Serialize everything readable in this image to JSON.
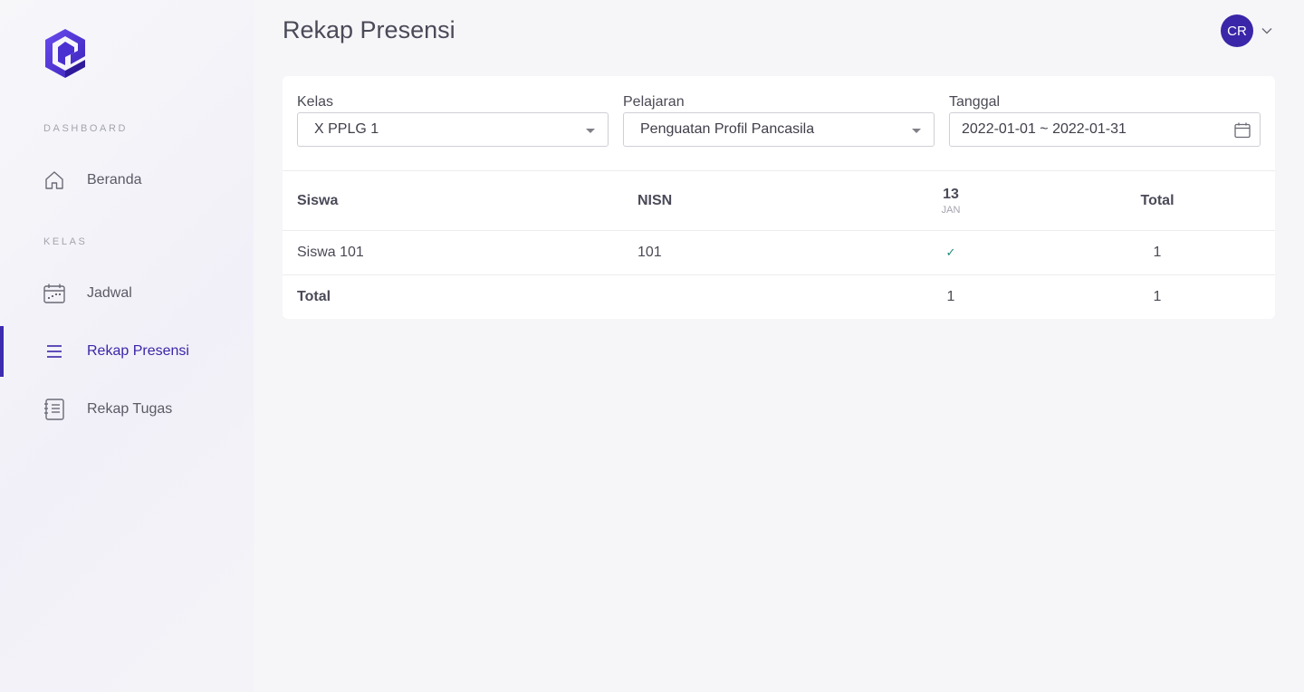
{
  "sidebar": {
    "sections": [
      {
        "label": "DASHBOARD"
      },
      {
        "label": "KELAS"
      }
    ],
    "items": [
      {
        "label": "Beranda",
        "icon": "home-icon"
      },
      {
        "label": "Jadwal",
        "icon": "calendar-icon"
      },
      {
        "label": "Rekap Presensi",
        "icon": "list-icon",
        "active": true
      },
      {
        "label": "Rekap Tugas",
        "icon": "notebook-icon"
      }
    ]
  },
  "header": {
    "title": "Rekap Presensi",
    "avatar_initials": "CR"
  },
  "filters": {
    "kelas": {
      "label": "Kelas",
      "value": "X PPLG 1"
    },
    "pelajaran": {
      "label": "Pelajaran",
      "value": "Penguatan Profil Pancasila"
    },
    "tanggal": {
      "label": "Tanggal",
      "value": "2022-01-01 ~ 2022-01-31"
    }
  },
  "table": {
    "headers": {
      "siswa": "Siswa",
      "nisn": "NISN",
      "date_day": "13",
      "date_month": "JAN",
      "total": "Total"
    },
    "rows": [
      {
        "siswa": "Siswa 101",
        "nisn": "101",
        "mark": "✓",
        "total": "1"
      }
    ],
    "footer": {
      "label": "Total",
      "date_total": "1",
      "total": "1"
    }
  },
  "colors": {
    "accent": "#3a26a8",
    "check": "#1f8a7a"
  }
}
